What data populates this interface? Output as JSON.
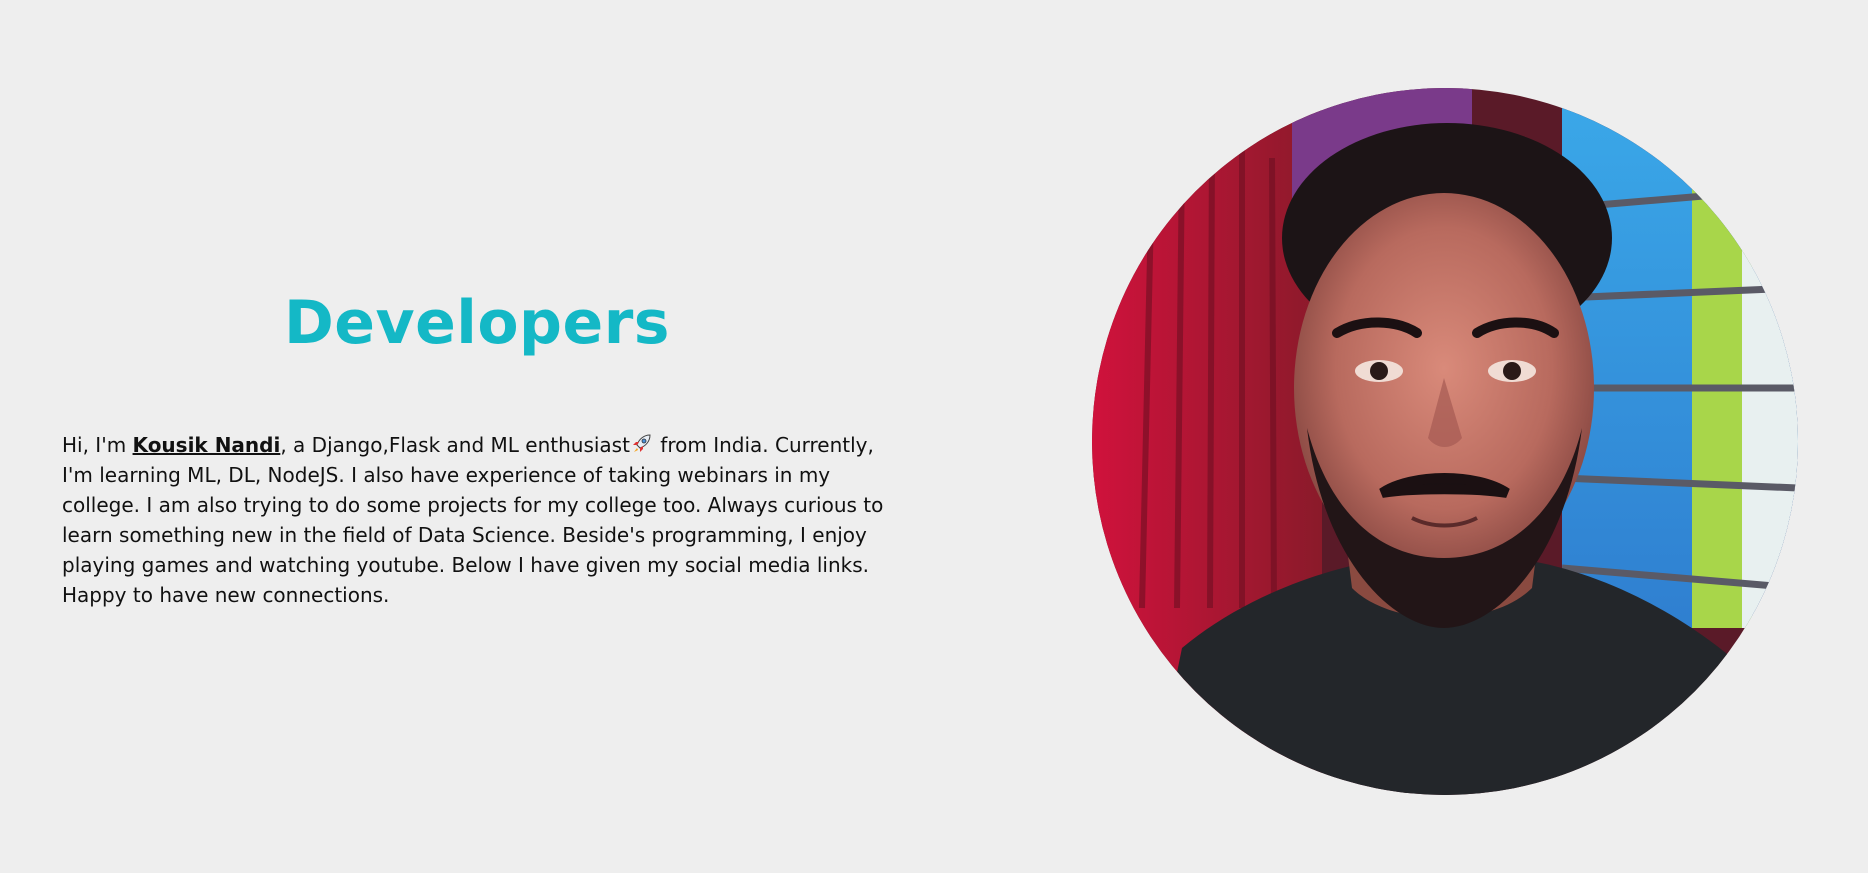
{
  "section": {
    "title": "Developers"
  },
  "bio": {
    "intro": "Hi, I'm ",
    "name": "Kousik Nandi",
    "after_name": ", a Django,Flask and ML enthusiast",
    "emoji_icon": "rocket-icon",
    "rest": " from India. Currently, I'm learning ML, DL, NodeJS. I also have experience of taking webinars in my college. I am also trying to do some projects for my college too. Always curious to learn something new in the field of Data Science. Beside's programming, I enjoy playing games and watching youtube. Below I have given my social media links. Happy to have new connections."
  },
  "colors": {
    "background": "#eeeeee",
    "title": "#14b8c6",
    "text": "#111111"
  }
}
